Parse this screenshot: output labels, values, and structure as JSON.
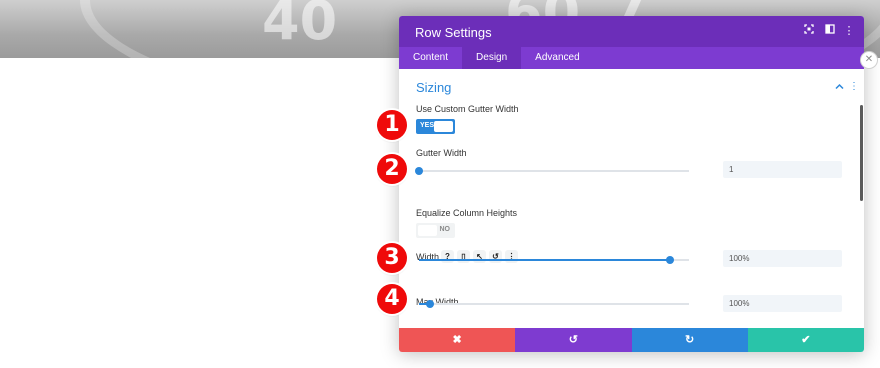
{
  "banner": {
    "numbers": [
      "40",
      "60",
      "7"
    ]
  },
  "modal": {
    "title": "Row Settings",
    "header_icons": [
      "fullscreen-icon",
      "split-view-icon",
      "kebab-icon"
    ],
    "tabs": [
      {
        "label": "Content",
        "active": false
      },
      {
        "label": "Design",
        "active": true
      },
      {
        "label": "Advanced",
        "active": false
      }
    ],
    "section": {
      "title": "Sizing",
      "fields": {
        "custom_gutter": {
          "label": "Use Custom Gutter Width",
          "toggle": "YES",
          "on": true
        },
        "gutter_width": {
          "label": "Gutter Width",
          "value": "1",
          "slider_fraction": 0.0
        },
        "equalize": {
          "label": "Equalize Column Heights",
          "toggle": "NO",
          "on": false
        },
        "width": {
          "label": "Width",
          "value": "100%",
          "slider_fraction": 0.93,
          "icons": [
            "?",
            "▯",
            "↖",
            "↺",
            "⋮"
          ]
        },
        "max_width": {
          "label": "Max Width",
          "value": "100%",
          "slider_fraction": 0.04
        }
      }
    },
    "footer": {
      "cancel_icon": "✖",
      "undo_icon": "↺",
      "redo_icon": "↻",
      "save_icon": "✔",
      "colors": {
        "cancel": "#ef5555",
        "undo": "#7e3bd0",
        "redo": "#2b87da",
        "save": "#29c4a9"
      }
    }
  },
  "annotations": [
    "1",
    "2",
    "3",
    "4"
  ],
  "colors": {
    "header": "#6c2eb9",
    "tabs": "#7d3bd1",
    "accent": "#2b87da",
    "badge": "#ef0a0a"
  }
}
